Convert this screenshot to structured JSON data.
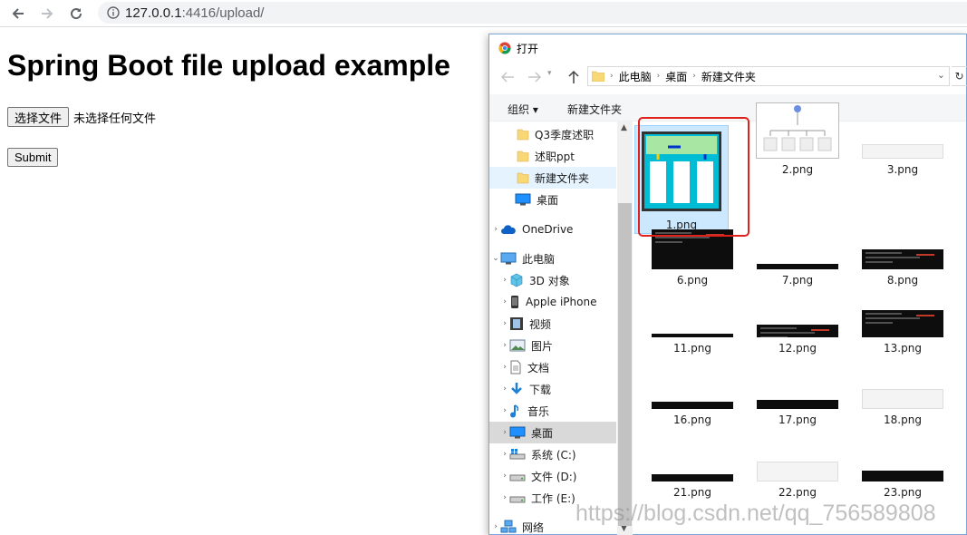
{
  "browser": {
    "url_host": "127.0.0.1",
    "url_rest": ":4416/upload/"
  },
  "page": {
    "title": "Spring Boot file upload example",
    "choose_file_label": "选择文件",
    "no_file_text": "未选择任何文件",
    "submit_label": "Submit"
  },
  "dialog": {
    "title": "打开",
    "breadcrumb": [
      "此电脑",
      "桌面",
      "新建文件夹"
    ],
    "organize_label": "组织 ▾",
    "new_folder_label": "新建文件夹",
    "nav_items": [
      "Q3季度述职",
      "述职ppt",
      "新建文件夹",
      "桌面",
      "OneDrive",
      "此电脑",
      "3D 对象",
      "Apple iPhone",
      "视频",
      "图片",
      "文档",
      "下载",
      "音乐",
      "桌面",
      "系统 (C:)",
      "文件 (D:)",
      "工作 (E:)",
      "网络"
    ],
    "files": [
      "1.png",
      "2.png",
      "3.png",
      "6.png",
      "7.png",
      "8.png",
      "11.png",
      "12.png",
      "13.png",
      "16.png",
      "17.png",
      "18.png",
      "21.png",
      "22.png",
      "23.png"
    ]
  },
  "watermark": "https://blog.csdn.net/qq_756589808",
  "colors": {
    "selection_outline": "#e0201a",
    "selection_fill": "#cce8ff"
  }
}
